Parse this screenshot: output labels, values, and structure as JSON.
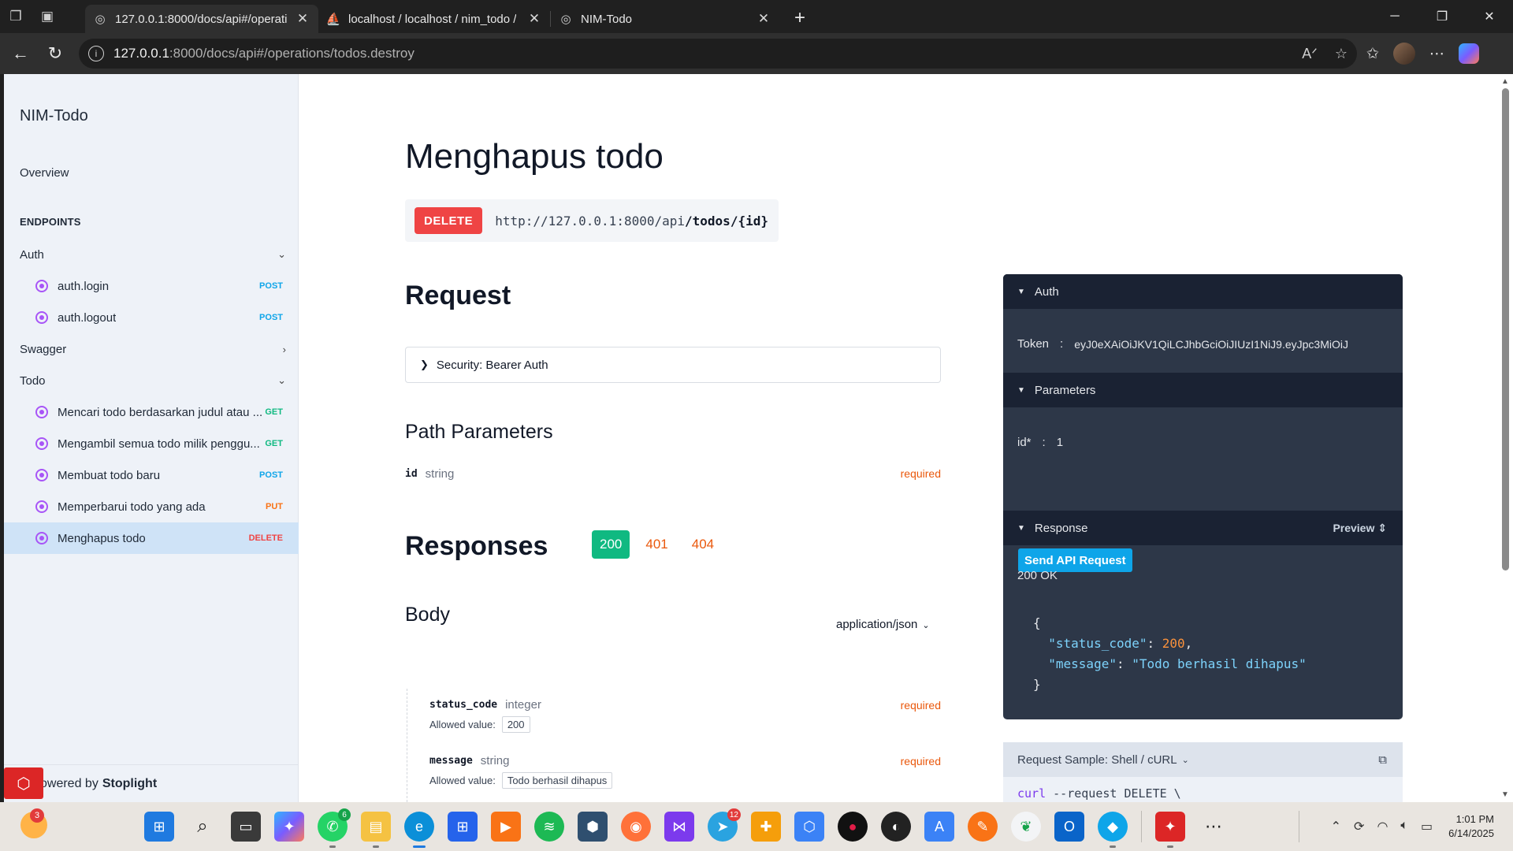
{
  "browser": {
    "tabs": [
      {
        "title": "127.0.0.1:8000/docs/api#/operati",
        "icon": "globe-icon",
        "active": true
      },
      {
        "title": "localhost / localhost / nim_todo /",
        "icon": "phpmyadmin-icon",
        "active": false
      },
      {
        "title": "NIM-Todo",
        "icon": "globe-icon",
        "active": false
      }
    ],
    "url_host": "127.0.0.1",
    "url_path": ":8000/docs/api#/operations/todos.destroy"
  },
  "sidebar": {
    "brand": "NIM-Todo",
    "overview": "Overview",
    "endpoints_heading": "ENDPOINTS",
    "groups": {
      "auth": "Auth",
      "swagger": "Swagger",
      "todo": "Todo"
    },
    "auth_items": [
      {
        "label": "auth.login",
        "method": "POST"
      },
      {
        "label": "auth.logout",
        "method": "POST"
      }
    ],
    "todo_items": [
      {
        "label": "Mencari todo berdasarkan judul atau ...",
        "method": "GET"
      },
      {
        "label": "Mengambil semua todo milik penggu...",
        "method": "GET"
      },
      {
        "label": "Membuat todo baru",
        "method": "POST"
      },
      {
        "label": "Memperbarui todo yang ada",
        "method": "PUT"
      },
      {
        "label": "Menghapus todo",
        "method": "DELETE"
      }
    ],
    "footer_prefix": "owered by",
    "footer_brand": "Stoplight"
  },
  "main": {
    "title": "Menghapus todo",
    "method": "DELETE",
    "url_base": "http://127.0.0.1:8000/api",
    "url_path": "/todos/{id}",
    "request_heading": "Request",
    "security_label": "Security: Bearer Auth",
    "path_params_heading": "Path Parameters",
    "path_params": [
      {
        "name": "id",
        "type": "string",
        "required": "required"
      }
    ],
    "responses_heading": "Responses",
    "response_codes": [
      "200",
      "401",
      "404"
    ],
    "body_heading": "Body",
    "content_type": "application/json",
    "body_fields": [
      {
        "name": "status_code",
        "type": "integer",
        "required": "required",
        "allowed_label": "Allowed value:",
        "allowed_value": "200"
      },
      {
        "name": "message",
        "type": "string",
        "required": "required",
        "allowed_label": "Allowed value:",
        "allowed_value": "Todo berhasil dihapus"
      }
    ]
  },
  "try_panel": {
    "auth_heading": "Auth",
    "token_label": "Token",
    "colon": ":",
    "token_value": "eyJ0eXAiOiJKV1QiLCJhbGciOiJIUzI1NiJ9.eyJpc3MiOiJ",
    "params_heading": "Parameters",
    "param_label": "id*",
    "param_value": "1",
    "send_button": "Send API Request",
    "response_heading": "Response",
    "preview_label": "Preview",
    "status_line": "200 OK",
    "json_open": "{",
    "json_key1": "\"status_code\"",
    "json_val1": "200",
    "json_key2": "\"message\"",
    "json_val2": "\"Todo berhasil dihapus\"",
    "json_close": "}"
  },
  "sample": {
    "heading": "Request Sample: Shell / cURL",
    "code_cmd": "curl",
    "code_rest": " --request DELETE \\"
  },
  "taskbar": {
    "weather_badge": "3",
    "whatsapp_badge": "6",
    "telegram_badge": "12",
    "time": "1:01 PM",
    "date": "6/14/2025"
  },
  "colors": {
    "delete": "#ef4444",
    "post": "#0ea5e9",
    "get": "#10b981",
    "put": "#f97316",
    "success": "#10b981",
    "panel": "#2d3748"
  }
}
